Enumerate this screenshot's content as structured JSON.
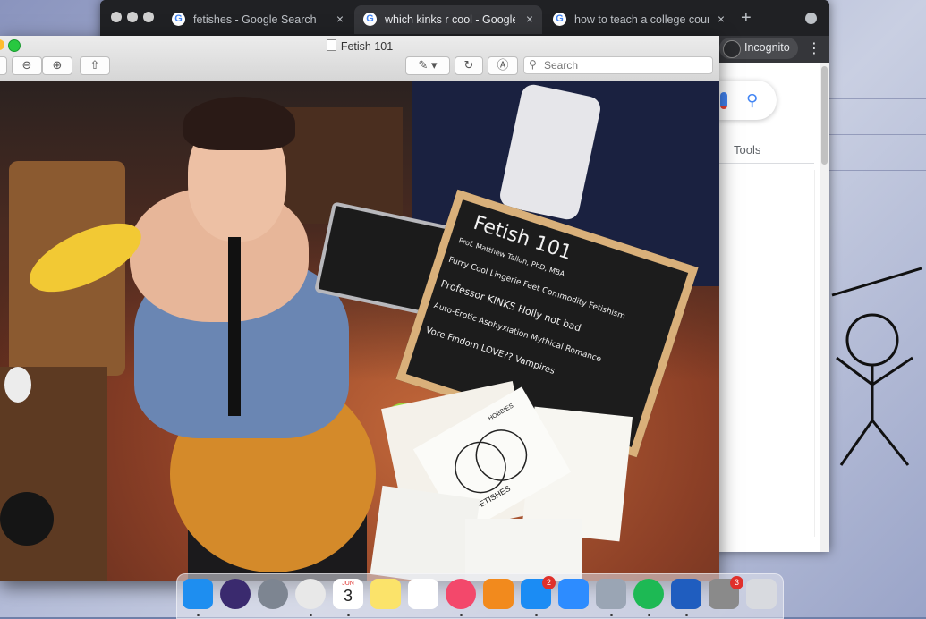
{
  "browser": {
    "tabs": [
      {
        "title": "fetishes - Google Search",
        "active": false
      },
      {
        "title": "which kinks r cool - Google Search",
        "active": true
      },
      {
        "title": "how to teach a college course",
        "active": false
      }
    ],
    "new_tab_symbol": "+",
    "close_symbol": "×",
    "profile_label": "Incognito",
    "menu_symbol": "⋮",
    "google": {
      "tools_label": "Tools",
      "search_icon": "magnifier-icon",
      "mic_icon": "microphone-icon"
    }
  },
  "preview": {
    "title": "Fetish 101",
    "search_placeholder": "Search",
    "toolbar_icons": [
      "zoom-out-icon",
      "zoom-in-icon",
      "share-icon",
      "markup-pen-icon",
      "rotate-icon",
      "annotate-icon"
    ],
    "photo_board_lines": [
      "Fetish 101",
      "Prof. Matthew Tallon, PhD, MBA",
      "Furry  Cool  Lingerie  Feet  Commodity Fetishism",
      "Professor  KINKS  Holly not bad",
      "Auto-Erotic Asphyxiation  Mythical Romance",
      "Vore  Findom  LOVE??  Vampires"
    ],
    "photo_paper_lines": [
      "FETISHES",
      "HOBBIES"
    ]
  },
  "dock": {
    "apps": [
      {
        "name": "finder",
        "color": "#1e8ef0"
      },
      {
        "name": "siri",
        "color": "#3a2a6e"
      },
      {
        "name": "launchpad",
        "color": "#7d8591"
      },
      {
        "name": "chrome",
        "color": "#e8e8e8"
      },
      {
        "name": "calendar",
        "color": "#ffffff",
        "month": "JUN",
        "day": "3"
      },
      {
        "name": "notes",
        "color": "#fbe36a"
      },
      {
        "name": "reminders",
        "color": "#ffffff"
      },
      {
        "name": "itunes",
        "color": "#f3486b"
      },
      {
        "name": "books",
        "color": "#f28a1d"
      },
      {
        "name": "app-store",
        "color": "#1b8cf4",
        "badge": "2"
      },
      {
        "name": "zoom",
        "color": "#2d8cff"
      },
      {
        "name": "preview",
        "color": "#9aa5b4"
      },
      {
        "name": "spotify",
        "color": "#1db954"
      },
      {
        "name": "word",
        "color": "#1f5dbf"
      },
      {
        "name": "system-preferences",
        "color": "#8a8a8a",
        "badge": "3"
      },
      {
        "name": "trash",
        "color": "#d8dadf"
      }
    ]
  }
}
